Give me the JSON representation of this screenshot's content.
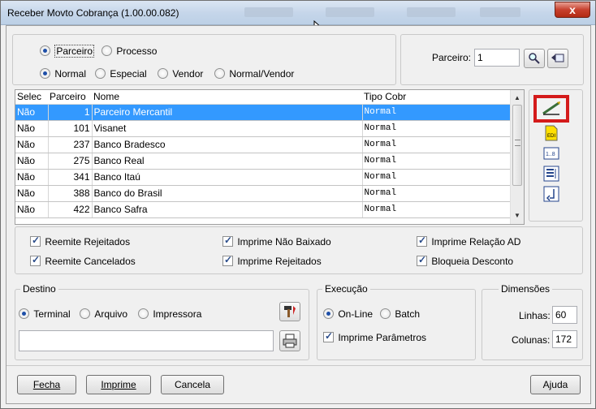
{
  "window": {
    "title": "Receber Movto Cobrança (1.00.00.082)",
    "close_label": "x"
  },
  "filter": {
    "type_options": [
      {
        "label": "Parceiro",
        "checked": true
      },
      {
        "label": "Processo",
        "checked": false
      }
    ],
    "mode_options": [
      {
        "label": "Normal",
        "checked": true
      },
      {
        "label": "Especial",
        "checked": false
      },
      {
        "label": "Vendor",
        "checked": false
      },
      {
        "label": "Normal/Vendor",
        "checked": false
      }
    ],
    "parceiro_label": "Parceiro:",
    "parceiro_value": "1",
    "search_icon": "search-icon",
    "return_icon": "return-icon"
  },
  "table": {
    "columns": [
      "Selec",
      "Parceiro",
      "Nome",
      "Tipo Cobr"
    ],
    "rows": [
      {
        "selec": "Não",
        "parceiro": "1",
        "nome": "Parceiro Mercantil",
        "tipo": "Normal",
        "selected": true
      },
      {
        "selec": "Não",
        "parceiro": "101",
        "nome": "Visanet",
        "tipo": "Normal"
      },
      {
        "selec": "Não",
        "parceiro": "237",
        "nome": "Banco Bradesco",
        "tipo": "Normal"
      },
      {
        "selec": "Não",
        "parceiro": "275",
        "nome": "Banco Real",
        "tipo": "Normal"
      },
      {
        "selec": "Não",
        "parceiro": "341",
        "nome": "Banco Itaú",
        "tipo": "Normal"
      },
      {
        "selec": "Não",
        "parceiro": "388",
        "nome": "Banco do Brasil",
        "tipo": "Normal"
      },
      {
        "selec": "Não",
        "parceiro": "422",
        "nome": "Banco Safra",
        "tipo": "Normal"
      }
    ]
  },
  "toolbar": {
    "items": [
      {
        "icon": "edit-pencil-icon",
        "glyph": "✎",
        "highlighted": true
      },
      {
        "icon": "edi-file-icon",
        "glyph": "EDI"
      },
      {
        "icon": "range-icon",
        "glyph": "1…8"
      },
      {
        "icon": "select-all-icon",
        "glyph": "≣"
      },
      {
        "icon": "clear-selection-icon",
        "glyph": "⇅"
      }
    ]
  },
  "options": {
    "items": [
      {
        "label": "Reemite Rejeitados",
        "checked": true
      },
      {
        "label": "Imprime Não Baixado",
        "checked": true
      },
      {
        "label": "Imprime Relação AD",
        "checked": true
      },
      {
        "label": "Reemite Cancelados",
        "checked": true
      },
      {
        "label": "Imprime Rejeitados",
        "checked": true
      },
      {
        "label": "Bloqueia Desconto",
        "checked": true
      }
    ]
  },
  "destino": {
    "title": "Destino",
    "options": [
      {
        "label": "Terminal",
        "checked": true
      },
      {
        "label": "Arquivo",
        "checked": false
      },
      {
        "label": "Impressora",
        "checked": false
      }
    ],
    "path_value": "",
    "tool_icon": "hammer-icon",
    "printer_icon": "printer-icon"
  },
  "execucao": {
    "title": "Execução",
    "options": [
      {
        "label": "On-Line",
        "checked": true
      },
      {
        "label": "Batch",
        "checked": false
      }
    ],
    "imprime_parametros": {
      "label": "Imprime Parâmetros",
      "checked": true
    }
  },
  "dimensoes": {
    "title": "Dimensões",
    "linhas_label": "Linhas:",
    "linhas_value": "60",
    "colunas_label": "Colunas:",
    "colunas_value": "172"
  },
  "buttons": {
    "fecha": "Fecha",
    "imprime": "Imprime",
    "cancela": "Cancela",
    "ajuda": "Ajuda"
  }
}
